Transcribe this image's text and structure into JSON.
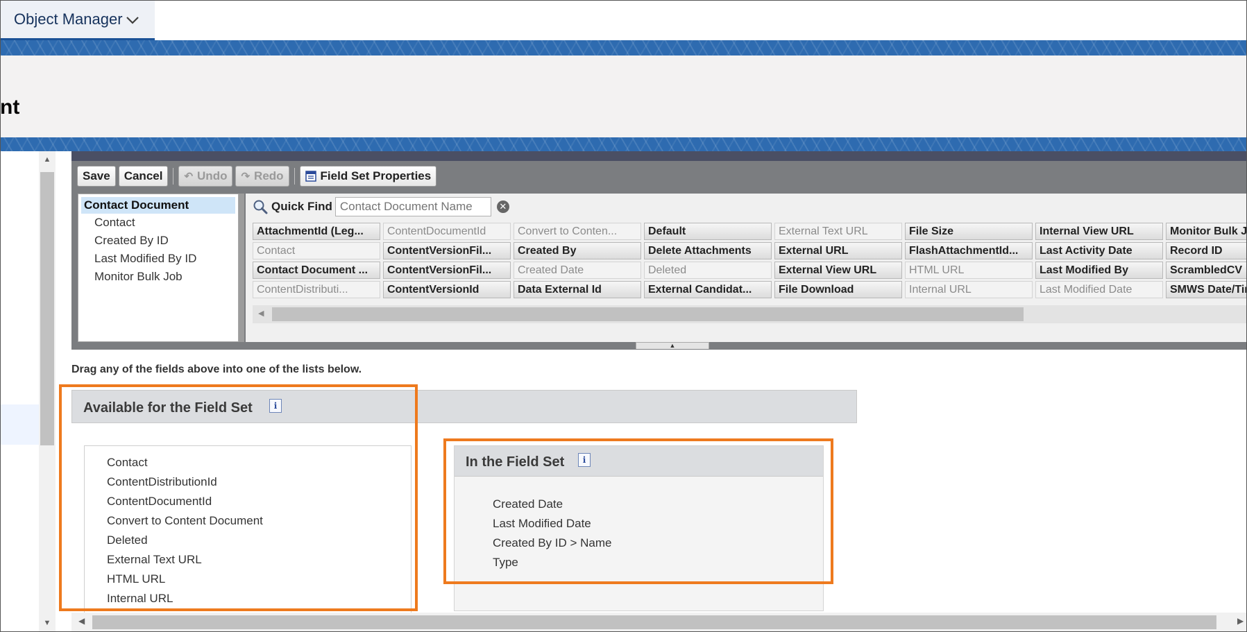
{
  "nav": {
    "tab_label": "Object Manager"
  },
  "header": {
    "title_fragment": "nt"
  },
  "toolbar": {
    "save": "Save",
    "cancel": "Cancel",
    "undo": "Undo",
    "redo": "Redo",
    "field_set_properties": "Field Set Properties"
  },
  "tree": {
    "root": "Contact Document",
    "items": [
      "Contact",
      "Created By ID",
      "Last Modified By ID",
      "Monitor Bulk Job"
    ]
  },
  "quick_find": {
    "label": "Quick Find",
    "placeholder": "Contact Document Name"
  },
  "fields": {
    "columns": [
      [
        {
          "label": "AttachmentId (Leg...",
          "used": false
        },
        {
          "label": "Contact",
          "used": true
        },
        {
          "label": "Contact Document ...",
          "used": false
        },
        {
          "label": "ContentDistributi...",
          "used": true
        }
      ],
      [
        {
          "label": "ContentDocumentId",
          "used": true
        },
        {
          "label": "ContentVersionFil...",
          "used": false
        },
        {
          "label": "ContentVersionFil...",
          "used": false
        },
        {
          "label": "ContentVersionId",
          "used": false
        }
      ],
      [
        {
          "label": "Convert to Conten...",
          "used": true
        },
        {
          "label": "Created By",
          "used": false
        },
        {
          "label": "Created Date",
          "used": true
        },
        {
          "label": "Data External Id",
          "used": false
        }
      ],
      [
        {
          "label": "Default",
          "used": false
        },
        {
          "label": "Delete Attachments",
          "used": false
        },
        {
          "label": "Deleted",
          "used": true
        },
        {
          "label": "External Candidat...",
          "used": false
        }
      ],
      [
        {
          "label": "External Text URL",
          "used": true
        },
        {
          "label": "External URL",
          "used": false
        },
        {
          "label": "External View URL",
          "used": false
        },
        {
          "label": "File Download",
          "used": false
        }
      ],
      [
        {
          "label": "File Size",
          "used": false
        },
        {
          "label": "FlashAttachmentId...",
          "used": false
        },
        {
          "label": "HTML URL",
          "used": true
        },
        {
          "label": "Internal URL",
          "used": true
        }
      ],
      [
        {
          "label": "Internal View URL",
          "used": false
        },
        {
          "label": "Last Activity Date",
          "used": false
        },
        {
          "label": "Last Modified By",
          "used": false
        },
        {
          "label": "Last Modified Date",
          "used": true
        }
      ],
      [
        {
          "label": "Monitor Bulk Jo",
          "used": false
        },
        {
          "label": "Record ID",
          "used": false
        },
        {
          "label": "ScrambledCV",
          "used": false
        },
        {
          "label": "SMWS Date/Tim",
          "used": false
        }
      ]
    ]
  },
  "instruction": "Drag any of the fields above into one of the lists below.",
  "available": {
    "title": "Available for the Field Set",
    "info": "i",
    "items": [
      "Contact",
      "ContentDistributionId",
      "ContentDocumentId",
      "Convert to Content Document",
      "Deleted",
      "External Text URL",
      "HTML URL",
      "Internal URL"
    ]
  },
  "in_set": {
    "title": "In the Field Set",
    "info": "i",
    "items": [
      "Created Date",
      "Last Modified Date",
      "Created By ID > Name",
      "Type"
    ]
  },
  "colors": {
    "highlight": "#ee7a1e",
    "brand_band": "#2e6bb0",
    "tree_selected": "#cfe5f8"
  }
}
